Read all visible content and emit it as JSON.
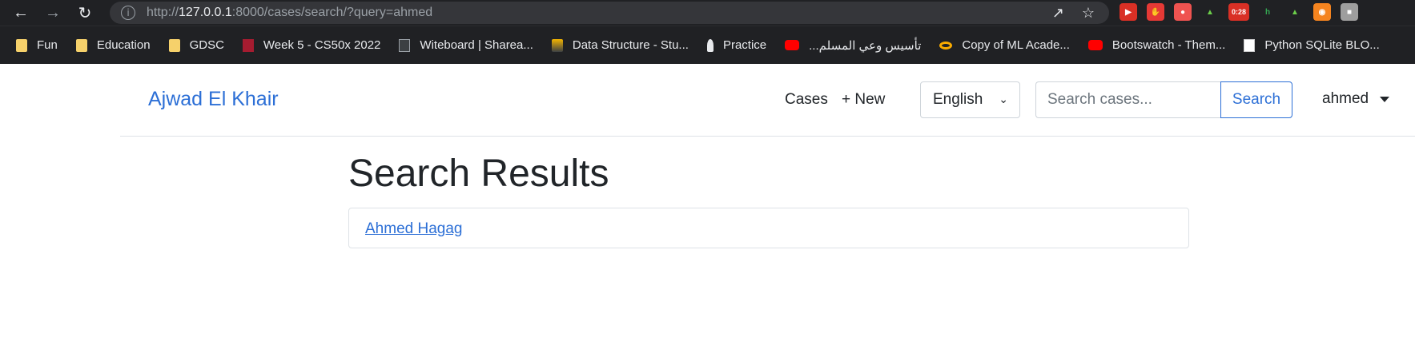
{
  "browser": {
    "url_prefix": "http://",
    "url_host": "127.0.0.1",
    "url_rest": ":8000/cases/search/?query=ahmed",
    "ext_timer": "0:28",
    "bookmarks": [
      {
        "label": "Fun",
        "icon": "folder-icon"
      },
      {
        "label": "Education",
        "icon": "folder-icon"
      },
      {
        "label": "GDSC",
        "icon": "folder-icon"
      },
      {
        "label": "Week 5 - CS50x 2022",
        "icon": "harvard-icon"
      },
      {
        "label": "Witeboard | Sharea...",
        "icon": "board-icon"
      },
      {
        "label": "Data Structure - Stu...",
        "icon": "stack-icon"
      },
      {
        "label": "Practice",
        "icon": "rocket-icon"
      },
      {
        "label": "...تأسيس وعي المسلم",
        "icon": "youtube-icon"
      },
      {
        "label": "Copy of ML Acade...",
        "icon": "colab-icon"
      },
      {
        "label": "Bootswatch - Them...",
        "icon": "youtube-icon"
      },
      {
        "label": "Python SQLite BLO...",
        "icon": "pynative-icon"
      }
    ]
  },
  "navbar": {
    "brand": "Ajwad El Khair",
    "cases": "Cases",
    "new": "+ New",
    "language": "English",
    "search_placeholder": "Search cases...",
    "search_button": "Search",
    "user": "ahmed"
  },
  "main": {
    "title": "Search Results",
    "results": [
      "Ahmed Hagag"
    ]
  },
  "colors": {
    "primary": "#2c6fd6",
    "chrome_bg": "#202124",
    "text": "#212529"
  }
}
